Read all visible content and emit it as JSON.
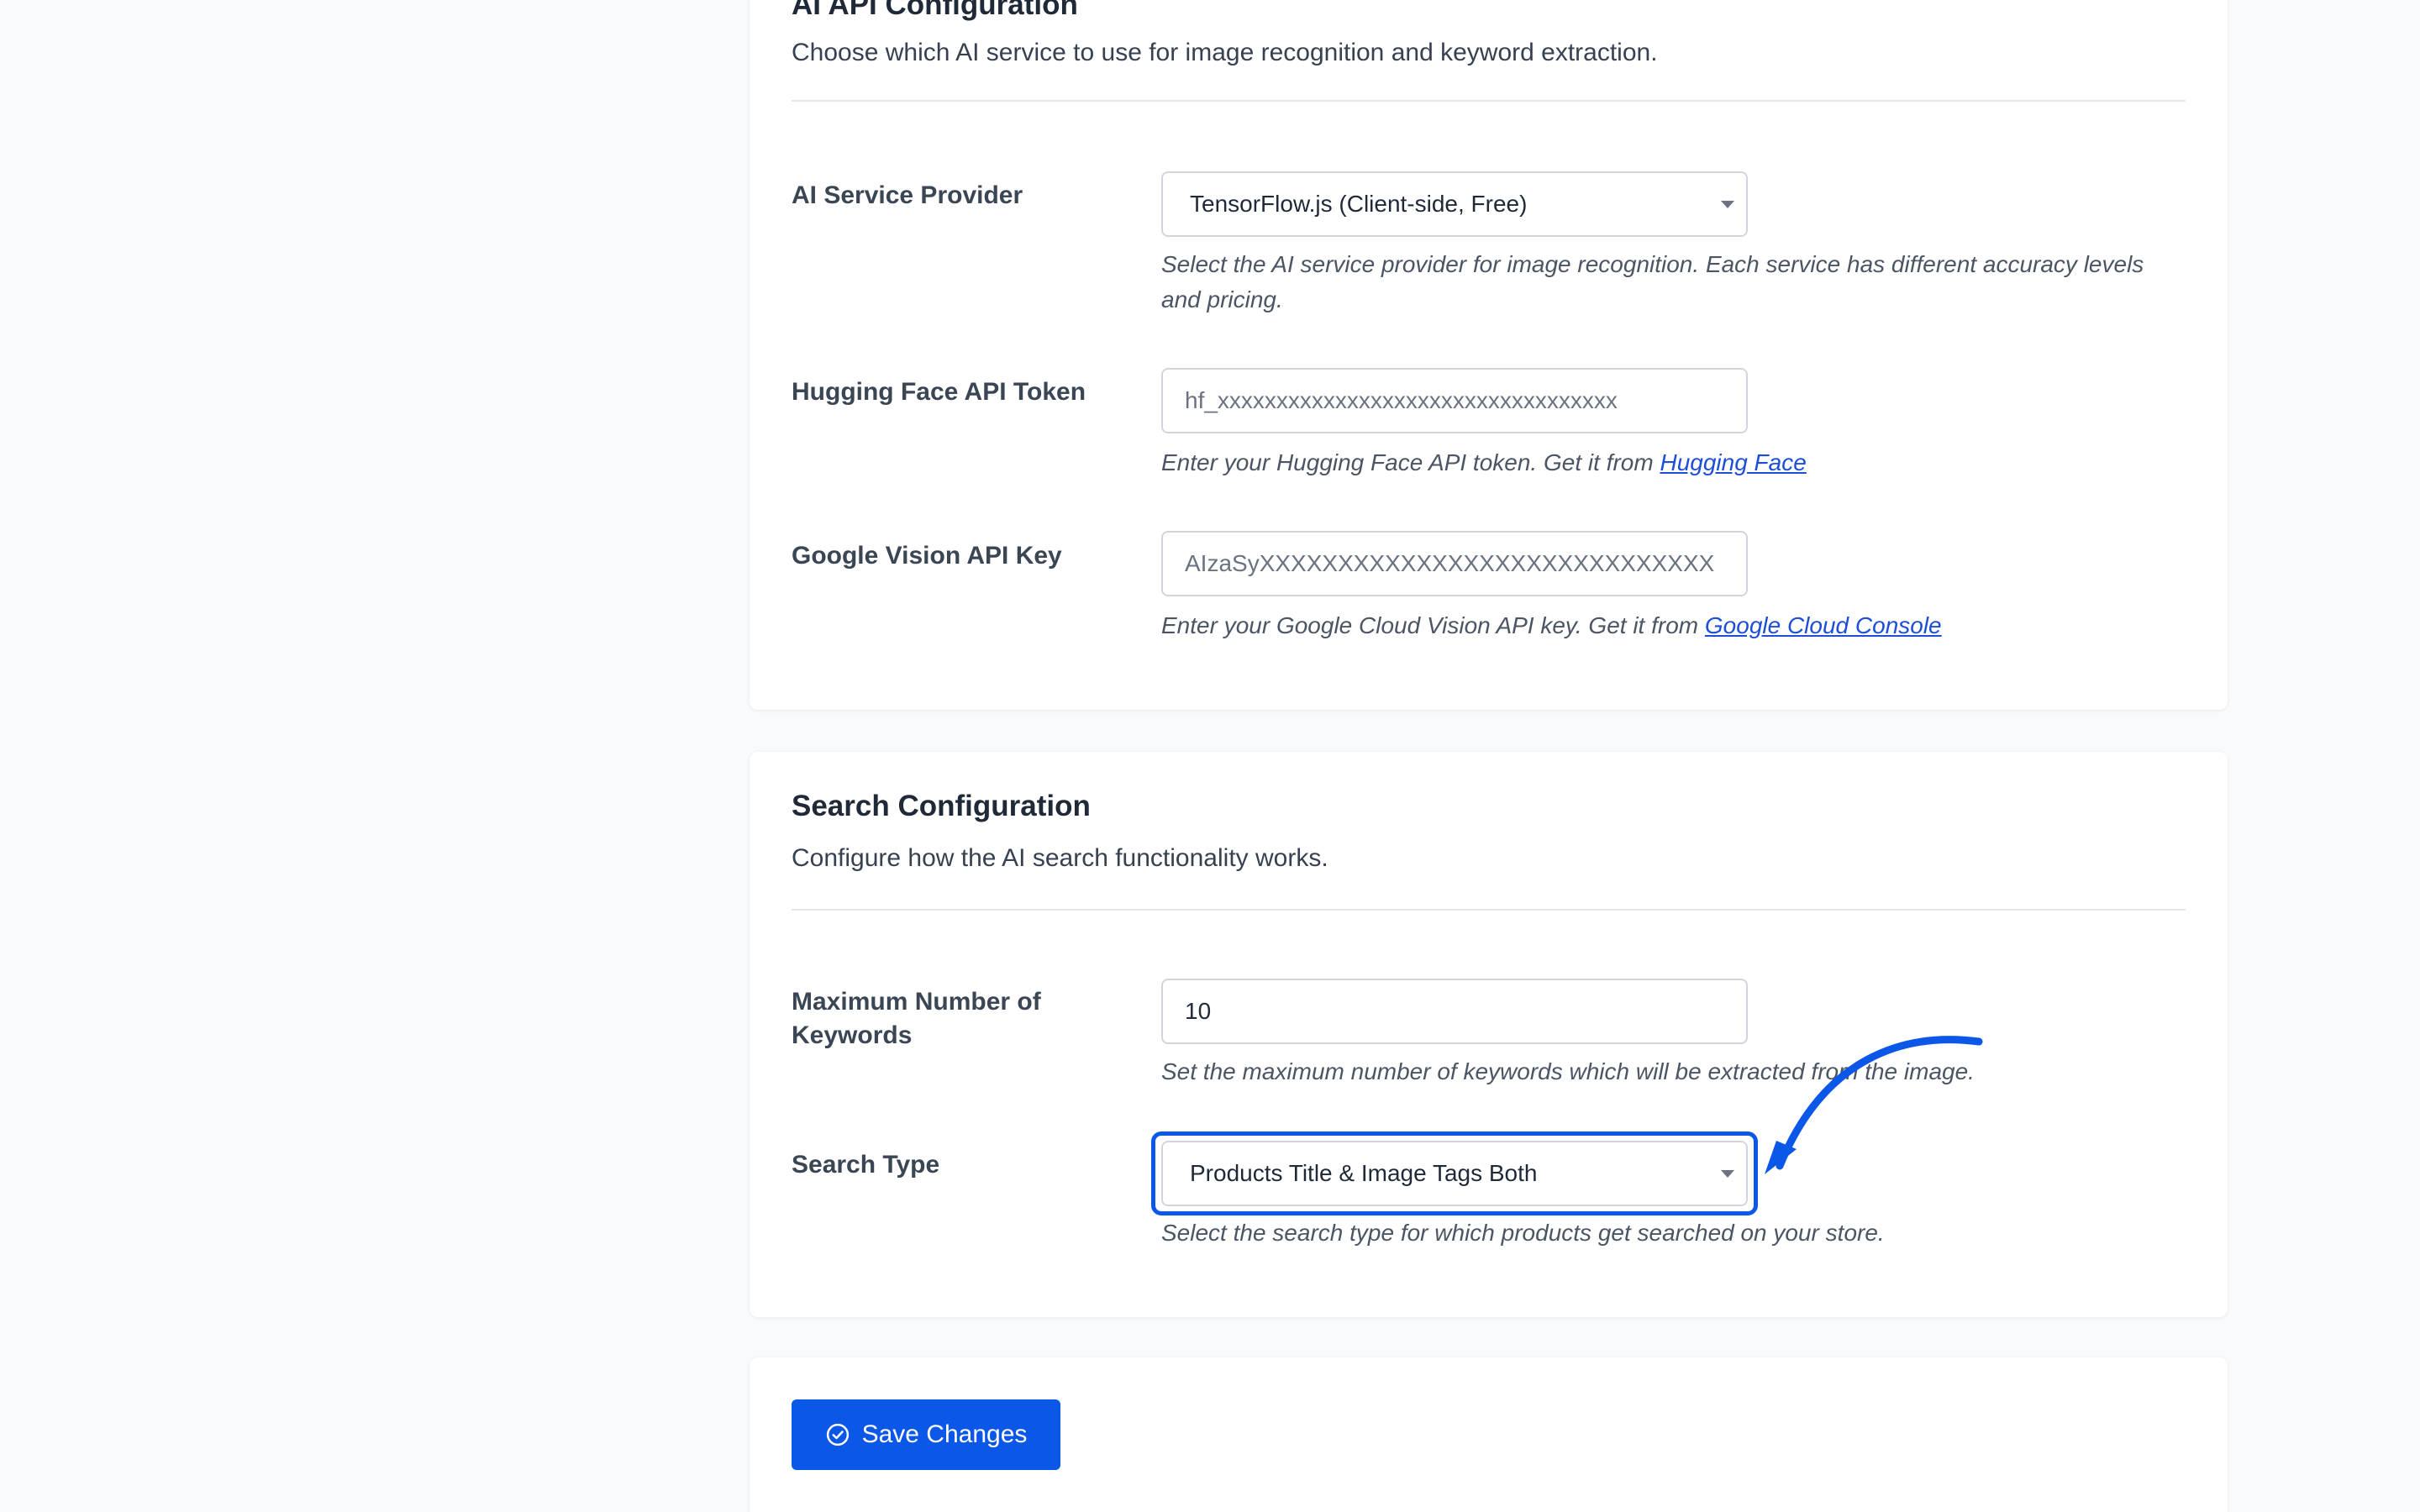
{
  "api_section": {
    "title": "AI API Configuration",
    "description": "Choose which AI service to use for image recognition and keyword extraction.",
    "provider": {
      "label": "AI Service Provider",
      "selected": "TensorFlow.js (Client-side, Free)",
      "help": "Select the AI service provider for image recognition. Each service has different accuracy levels and pricing."
    },
    "hf_token": {
      "label": "Hugging Face API Token",
      "placeholder": "hf_xxxxxxxxxxxxxxxxxxxxxxxxxxxxxxxxxx",
      "help_prefix": "Enter your Hugging Face API token. Get it from",
      "help_link": "Hugging Face"
    },
    "vision_key": {
      "label": "Google Vision API Key",
      "placeholder": "AIzaSyXXXXXXXXXXXXXXXXXXXXXXXXXXXXX",
      "help_prefix": "Enter your Google Cloud Vision API key. Get it from",
      "help_link": "Google Cloud Console"
    }
  },
  "search_section": {
    "title": "Search Configuration",
    "description": "Configure how the AI search functionality works.",
    "max_keywords": {
      "label": "Maximum Number of Keywords",
      "value": "10",
      "help": "Set the maximum number of keywords which will be extracted from the image."
    },
    "search_type": {
      "label": "Search Type",
      "selected": "Products Title & Image Tags Both",
      "help": "Select the search type for which products get searched on your store."
    }
  },
  "actions": {
    "save_label": "Save Changes"
  },
  "colors": {
    "accent": "#0b57e8",
    "link": "#1d4ed8",
    "background": "#f9fafb",
    "card": "#ffffff"
  },
  "icons": {
    "save_icon": "check-circle-icon",
    "select_caret": "caret-down-icon",
    "annotation": "curved-arrow-icon"
  }
}
